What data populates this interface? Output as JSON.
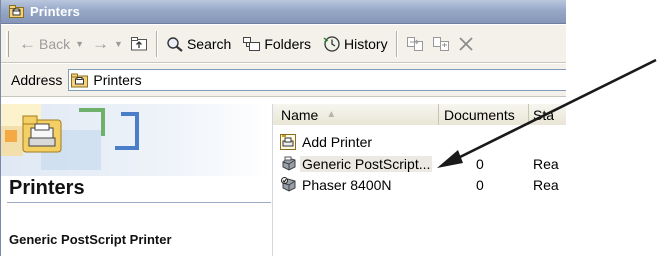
{
  "window": {
    "title": "Printers"
  },
  "toolbar": {
    "back_label": "Back",
    "search_label": "Search",
    "folders_label": "Folders",
    "history_label": "History"
  },
  "address": {
    "label": "Address",
    "value": "Printers"
  },
  "task_pane": {
    "title": "Printers",
    "selected_printer": "Generic PostScript Printer"
  },
  "list": {
    "columns": {
      "name": "Name",
      "documents": "Documents",
      "status": "Sta"
    },
    "rows": [
      {
        "name": "Add Printer",
        "documents": "",
        "status": "",
        "icon": "add-printer-icon"
      },
      {
        "name": "Generic PostScript...",
        "documents": "0",
        "status": "Rea",
        "icon": "printer-icon"
      },
      {
        "name": "Phaser 8400N",
        "documents": "0",
        "status": "Rea",
        "icon": "printer-icon"
      }
    ]
  },
  "colors": {
    "titlebar": "#97a8c8",
    "toolbar": "#f3f1ea",
    "header": "#ece9d8",
    "annotation_arrow": "#1a1a1a"
  }
}
